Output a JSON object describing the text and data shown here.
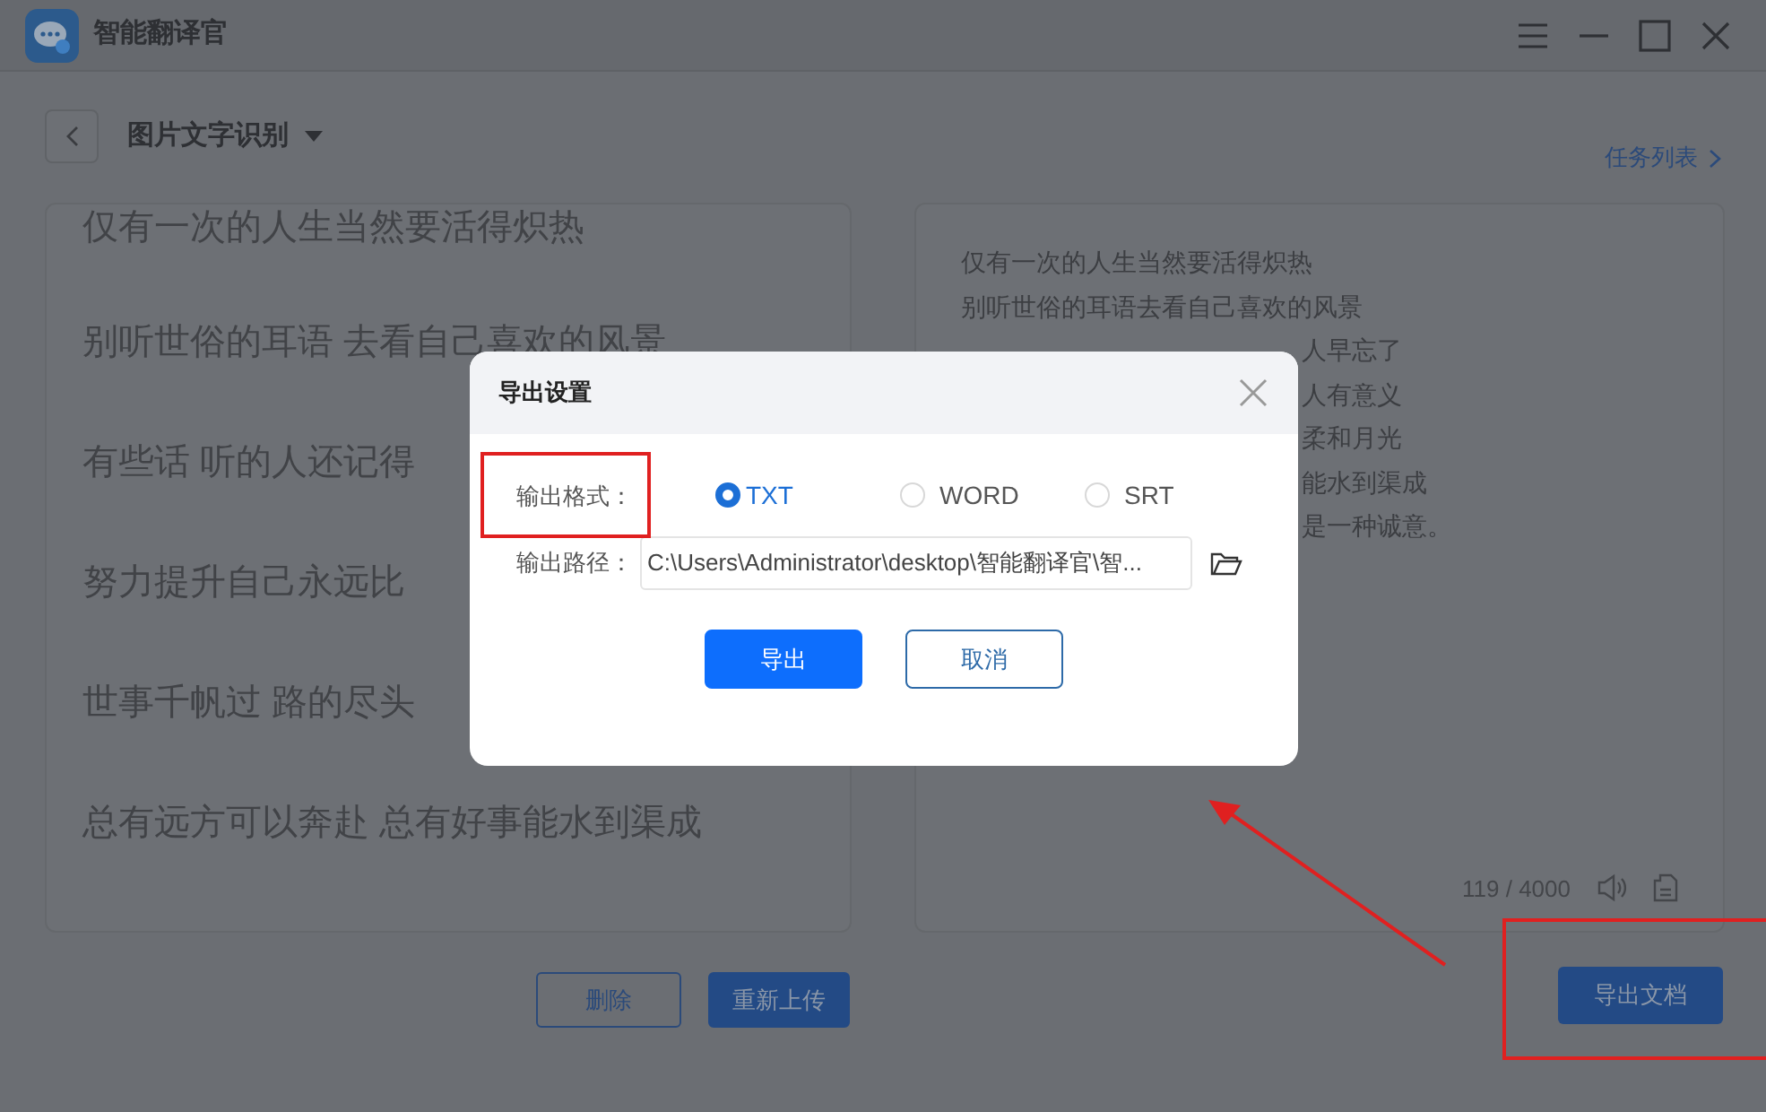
{
  "window": {
    "title": "智能翻译官"
  },
  "toolbar": {
    "mode": "图片文字识别",
    "task_list_link": "任务列表"
  },
  "source_lines": [
    "仅有一次的人生当然要活得炽热",
    "别听世俗的耳语 去看自己喜欢的风景",
    "有些话 听的人还记得",
    "努力提升自己永远比",
    "世事千帆过 路的尽头",
    "总有远方可以奔赴 总有好事能水到渠成"
  ],
  "source_buttons": [
    {
      "label": "删除",
      "kind": "outline"
    },
    {
      "label": "重新上传",
      "kind": "primary"
    }
  ],
  "result": {
    "lines": [
      {
        "text": "仅有一次的人生当然要活得炽热",
        "kind": "full"
      },
      {
        "text": "别听世俗的耳语去看自己喜欢的风景",
        "kind": "full"
      },
      {
        "text": "人早忘了",
        "kind": "partial"
      },
      {
        "text": "人有意义",
        "kind": "partial"
      },
      {
        "text": "柔和月光",
        "kind": "partial"
      },
      {
        "text": "能水到渠成",
        "kind": "partial"
      },
      {
        "text": "是一种诚意。",
        "kind": "partial"
      }
    ],
    "char_count": "119 / 4000"
  },
  "export_button": "导出文档",
  "dialog": {
    "title": "导出设置",
    "format_label": "输出格式：",
    "formats": [
      {
        "label": "TXT",
        "selected": true
      },
      {
        "label": "WORD",
        "selected": false
      },
      {
        "label": "SRT",
        "selected": false
      }
    ],
    "path_label": "输出路径：",
    "path": "C:\\Users\\Administrator\\desktop\\智能翻译官\\智...",
    "buttons": [
      {
        "label": "导出",
        "kind": "primary"
      },
      {
        "label": "取消",
        "kind": "outline"
      }
    ]
  }
}
